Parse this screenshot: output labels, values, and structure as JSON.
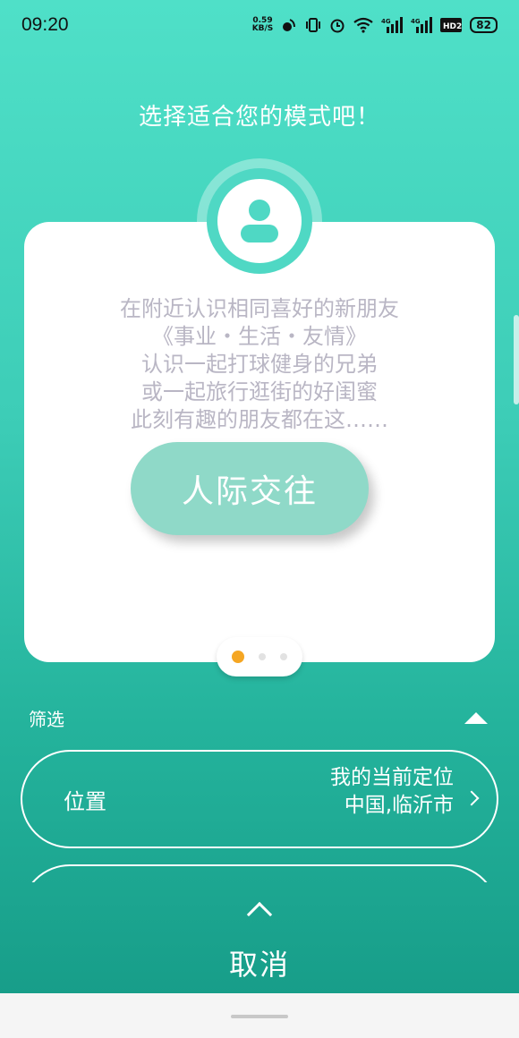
{
  "status_bar": {
    "time": "09:20",
    "net_speed_value": "0.59",
    "net_speed_unit": "KB/S",
    "network_labels": [
      "4G",
      "4G"
    ],
    "hd_label": "HD2",
    "battery": "82",
    "icons": [
      "net-speed-icon",
      "nfc-icon",
      "vibrate-icon",
      "alarm-icon",
      "wifi-icon",
      "signal-4g-icon",
      "signal-4g-icon",
      "hd-icon",
      "battery-icon"
    ]
  },
  "page": {
    "title": "选择适合您的模式吧！"
  },
  "card": {
    "icon": "user-icon",
    "description": [
      "在附近认识相同喜好的新朋友",
      "《事业・生活・友情》",
      "认识一起打球健身的兄弟",
      "或一起旅行逛街的好闺蜜",
      "此刻有趣的朋友都在这……"
    ],
    "button_label": "人际交往",
    "pager": {
      "count": 3,
      "active_index": 0
    }
  },
  "filter": {
    "label": "筛选",
    "toggle_icon": "triangle-up-icon",
    "location": {
      "label": "位置",
      "value_line1": "我的当前定位",
      "value_line2": "中国,临沂市",
      "icon": "chevron-right-icon"
    }
  },
  "footer": {
    "collapse_icon": "chevron-up-icon",
    "cancel_label": "取消"
  },
  "colors": {
    "gradient_top": "#4fe0c8",
    "gradient_bottom": "#159a86",
    "accent": "#4fd8c4",
    "button": "#8fd9c8",
    "pager_active": "#f5a623",
    "description_text": "#b9b6c4"
  }
}
